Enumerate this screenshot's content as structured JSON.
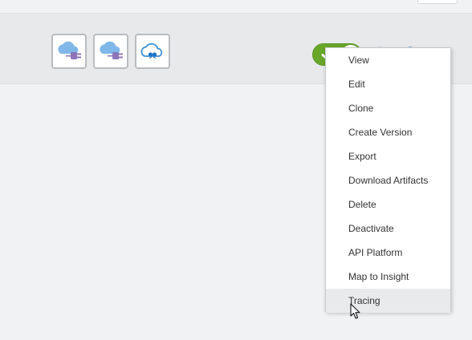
{
  "integration_row": {
    "adapter_icons": [
      "cloud-plug-icon",
      "cloud-plug-icon",
      "cloud-exchange-icon"
    ],
    "activation_toggle": {
      "state": "on",
      "icon": "checkmark-icon"
    },
    "tools": [
      "gear-icon",
      "info-icon",
      "menu-list-icon"
    ]
  },
  "actions_menu": {
    "items": [
      {
        "label": "View"
      },
      {
        "label": "Edit"
      },
      {
        "label": "Clone"
      },
      {
        "label": "Create Version"
      },
      {
        "label": "Export"
      },
      {
        "label": "Download Artifacts"
      },
      {
        "label": "Delete"
      },
      {
        "label": "Deactivate"
      },
      {
        "label": "API Platform"
      },
      {
        "label": "Map to Insight"
      },
      {
        "label": "Tracing"
      }
    ],
    "hovered_item": "Tracing"
  },
  "colors": {
    "toggle_on": "#68a72a",
    "icon_blue": "#1f74c7",
    "cloud_blue": "#7fb8e8",
    "plug_purple": "#8b75b8"
  }
}
